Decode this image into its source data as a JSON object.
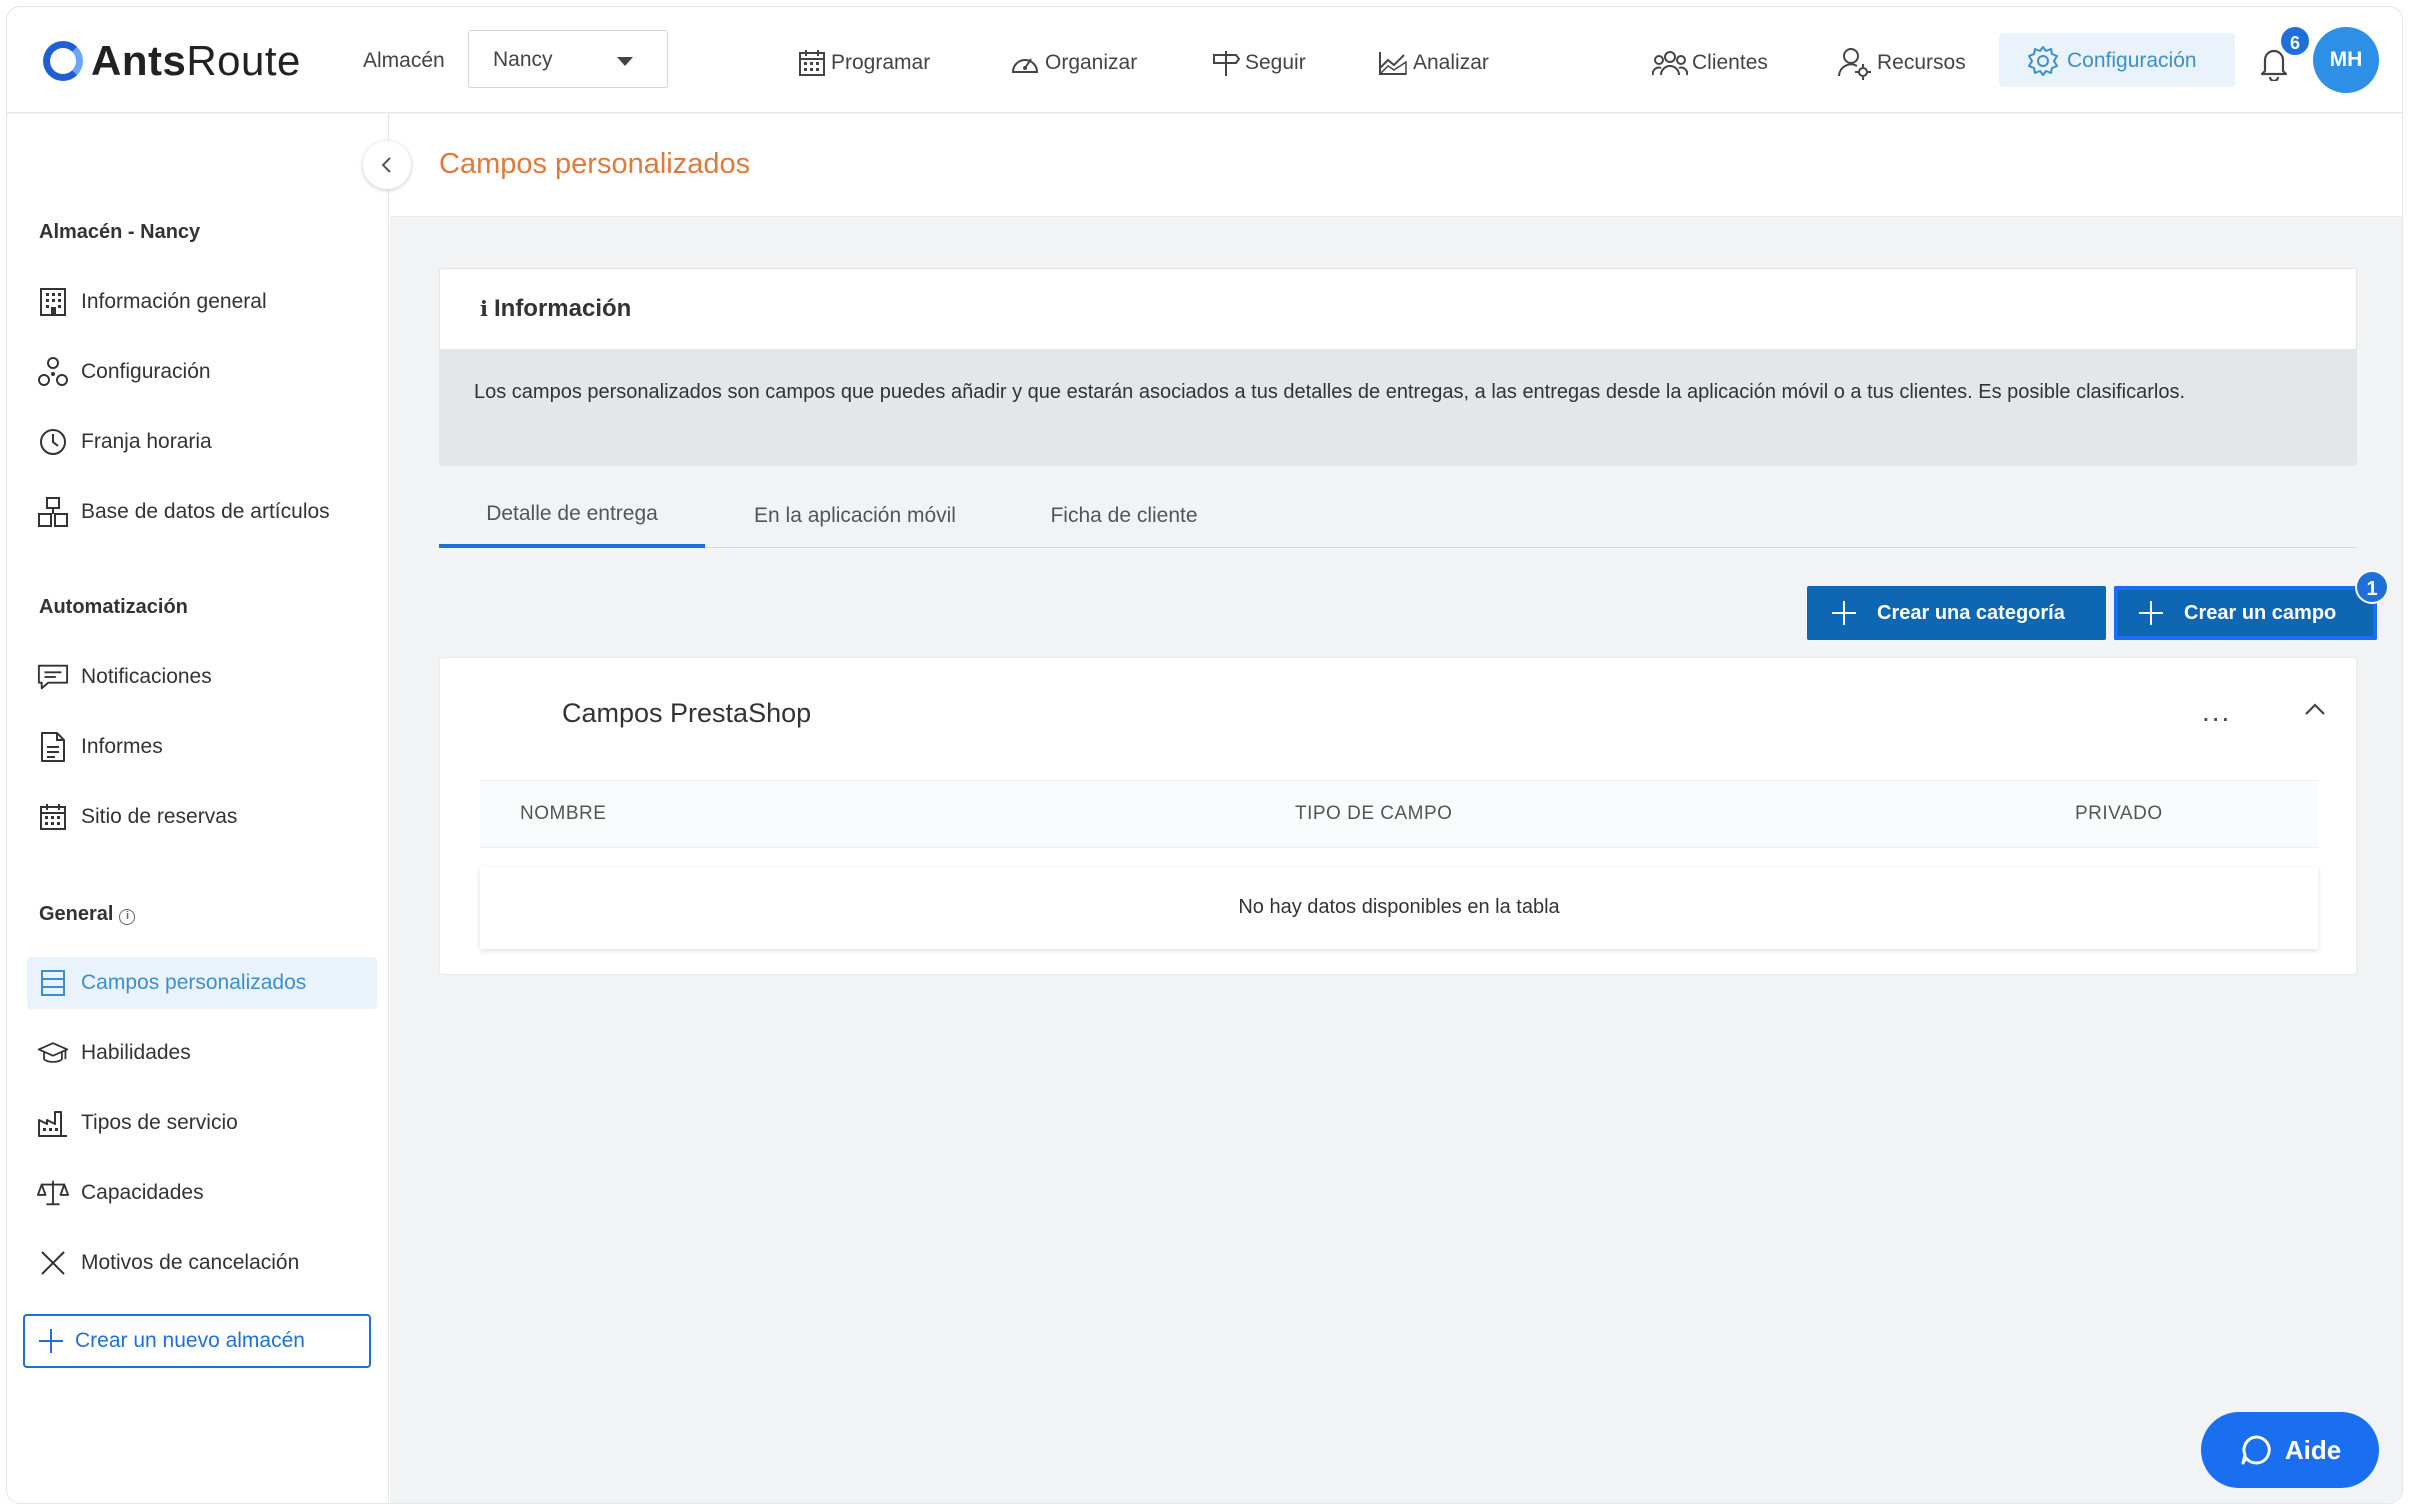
{
  "app": {
    "logo_bold": "Ants",
    "logo_regular": "Route"
  },
  "topbar": {
    "warehouse_label": "Almacén",
    "warehouse_value": "Nancy",
    "nav": {
      "programar": "Programar",
      "organizar": "Organizar",
      "seguir": "Seguir",
      "analizar": "Analizar",
      "clientes": "Clientes",
      "recursos": "Recursos",
      "configuracion": "Configuración"
    },
    "notification_count": "6",
    "avatar_initials": "MH"
  },
  "sidebar": {
    "section_warehouse": "Almacén - Nancy",
    "warehouse_items": [
      {
        "label": "Información general",
        "icon": "building-icon"
      },
      {
        "label": "Configuración",
        "icon": "nodes-icon"
      },
      {
        "label": "Franja horaria",
        "icon": "clock-icon"
      },
      {
        "label": "Base de datos de artículos",
        "icon": "boxes-icon"
      }
    ],
    "section_automation": "Automatización",
    "automation_items": [
      {
        "label": "Notificaciones",
        "icon": "message-icon"
      },
      {
        "label": "Informes",
        "icon": "document-icon"
      },
      {
        "label": "Sitio de reservas",
        "icon": "calendar-icon"
      }
    ],
    "section_general": "General",
    "general_items": [
      {
        "label": "Campos personalizados",
        "icon": "list-icon",
        "active": true
      },
      {
        "label": "Habilidades",
        "icon": "graduation-cap-icon"
      },
      {
        "label": "Tipos de servicio",
        "icon": "factory-icon"
      },
      {
        "label": "Capacidades",
        "icon": "scale-icon"
      },
      {
        "label": "Motivos de cancelación",
        "icon": "x-icon"
      }
    ],
    "new_warehouse": "Crear un nuevo almacén"
  },
  "main": {
    "page_title": "Campos personalizados",
    "info": {
      "title": "Información",
      "body": "Los campos personalizados son campos que puedes añadir y que estarán asociados a tus detalles de entregas, a las entregas desde la aplicación móvil o a tus clientes. Es posible clasificarlos."
    },
    "tabs": [
      "Detalle de entrega",
      "En la aplicación móvil",
      "Ficha de cliente"
    ],
    "active_tab": 0,
    "buttons": {
      "create_category": "Crear una categoría",
      "create_field": "Crear un campo",
      "create_field_badge": "1"
    },
    "category": {
      "title": "Campos PrestaShop",
      "more": "...",
      "columns": [
        "NOMBRE",
        "TIPO DE CAMPO",
        "PRIVADO"
      ],
      "empty_message": "No hay datos disponibles en la tabla"
    }
  },
  "help": {
    "label": "Aide"
  },
  "colors": {
    "accent": "#1e6fd9",
    "primary_button": "#0f66b2",
    "title_orange": "#e07a3a",
    "active_nav": "#3a8fd0"
  }
}
